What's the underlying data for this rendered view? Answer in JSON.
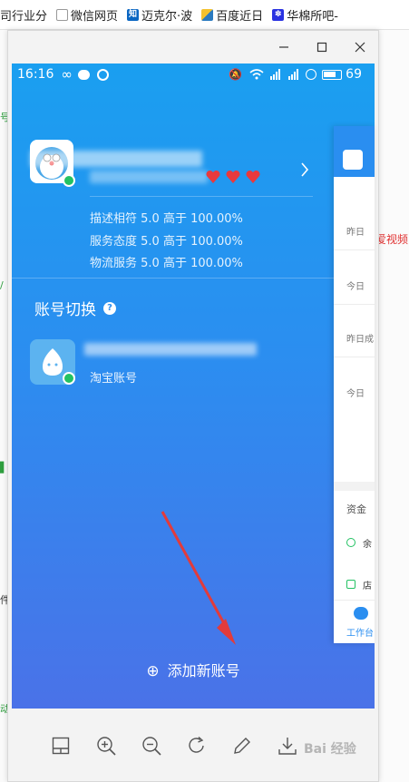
{
  "bookmarks": {
    "items": [
      {
        "label": "司行业分",
        "icon": "folder-icon",
        "color": "#f0a020"
      },
      {
        "label": "微信网页",
        "icon": "page-icon",
        "color": "#999999"
      },
      {
        "label": "迈克尔·波",
        "icon": "zhihu-icon",
        "color": "#0a66c2"
      },
      {
        "label": "百度近日",
        "icon": "baidu-tieba-icon",
        "color": "#2a7ac0"
      },
      {
        "label": "华棉所吧-",
        "icon": "paw-icon",
        "color": "#2932e1"
      }
    ]
  },
  "statusbar": {
    "time": "16:16",
    "battery": "69"
  },
  "account": {
    "stats": [
      "描述相符 5.0 高于 100.00%",
      "服务态度 5.0 高于 100.00%",
      "物流服务 5.0 高于 100.00%"
    ]
  },
  "switch_section": {
    "title": "账号切换",
    "help_glyph": "?",
    "taobao_label": "淘宝账号"
  },
  "add_account": {
    "label": "添加新账号",
    "glyph": "⊕"
  },
  "right_panel": {
    "items": [
      "昨日",
      "今日",
      "昨日成",
      "今日",
      "资金",
      "余",
      "店",
      "工作台"
    ],
    "red_text": "爱视频"
  },
  "watermark": "Bai 经验",
  "colors": {
    "accent": "#2b8ef0",
    "heart": "#e8393d",
    "verified": "#23c263",
    "arrow": "#e23b3b"
  }
}
